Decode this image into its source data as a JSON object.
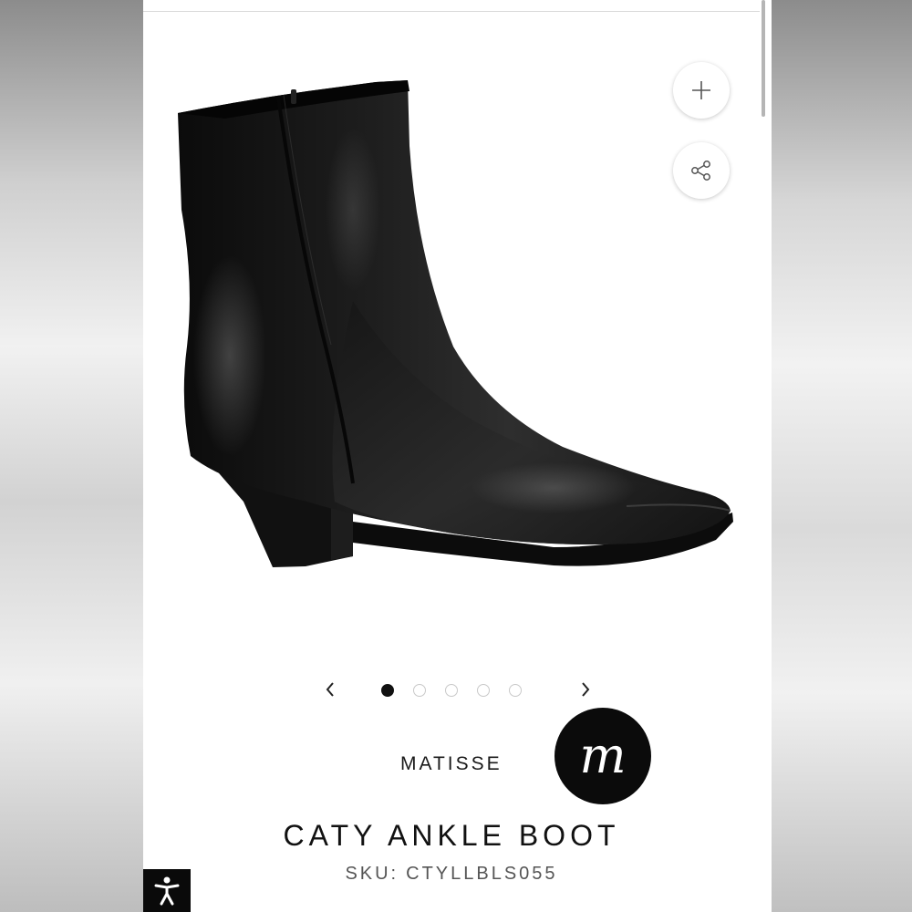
{
  "actions": {
    "add_icon": "plus-icon",
    "share_icon": "share-icon"
  },
  "carousel": {
    "prev_icon": "chevron-left-icon",
    "next_icon": "chevron-right-icon",
    "total_slides": 5,
    "active_slide": 1
  },
  "product": {
    "brand": "MATISSE",
    "brand_logo_letter": "m",
    "title": "CATY ANKLE BOOT",
    "sku_label": "SKU:",
    "sku_value": "CTYLLBLS055",
    "image_icon": "ankle-boot-image"
  },
  "accessibility": {
    "icon": "accessibility-icon",
    "color": "#0a0a0a"
  },
  "colors": {
    "background": "#ffffff",
    "text": "#111111",
    "sku_text": "#555555",
    "logo_bg": "#0b0b0b"
  }
}
